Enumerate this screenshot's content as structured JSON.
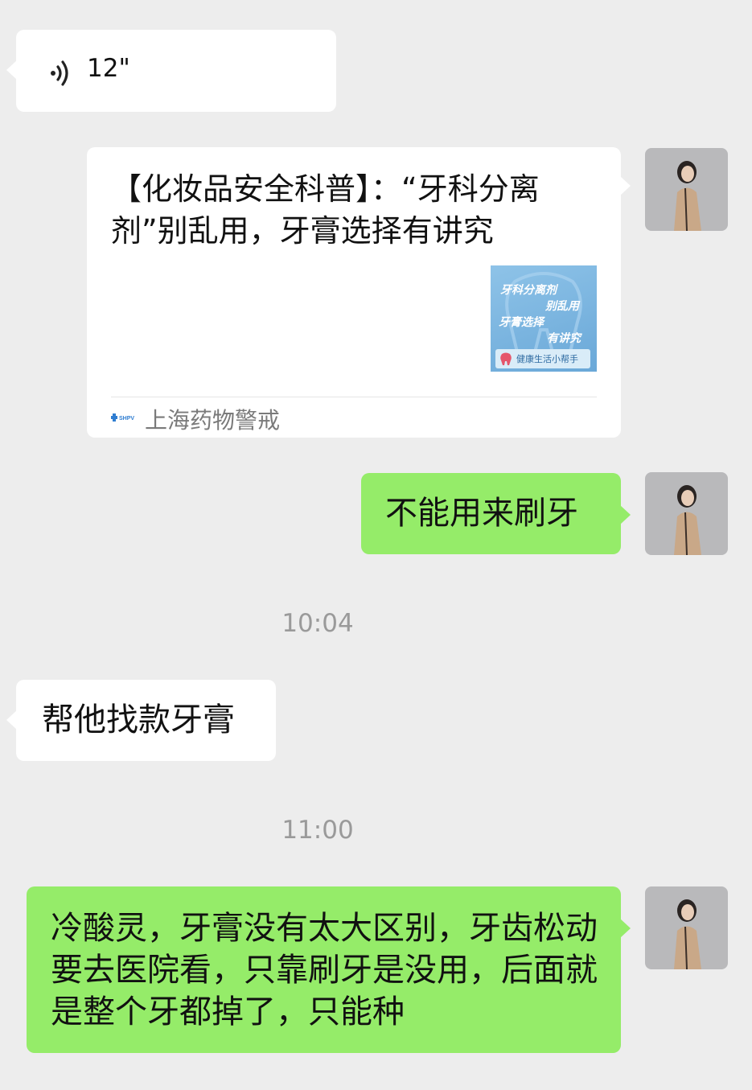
{
  "messages": {
    "voice": {
      "duration": "12\"",
      "icon": "voice-wave-icon"
    },
    "link_card": {
      "title": "【化妆品安全科普】：“牙科分离剂”别乱用，牙膏选择有讲究",
      "thumbnail": {
        "line1": "牙科分离剂",
        "line2": "别乱用",
        "line3": "牙膏选择",
        "line4": "有讲究",
        "band_text": "健康生活小帮手"
      },
      "source_logo": "SHPV",
      "source_name": "上海药物警戒"
    },
    "sent_1": "不能用来刷牙",
    "time_1": "10:04",
    "received_1": "帮他找款牙膏",
    "time_2": "11:00",
    "sent_2": "冷酸灵，牙膏没有太大区别，牙齿松动要去医院看，只靠刷牙是没用，后面就是整个牙都掉了，只能种"
  },
  "colors": {
    "background": "#ededed",
    "sent_bubble": "#95ec69",
    "received_bubble": "#ffffff",
    "timestamp": "#9a9a9a"
  }
}
